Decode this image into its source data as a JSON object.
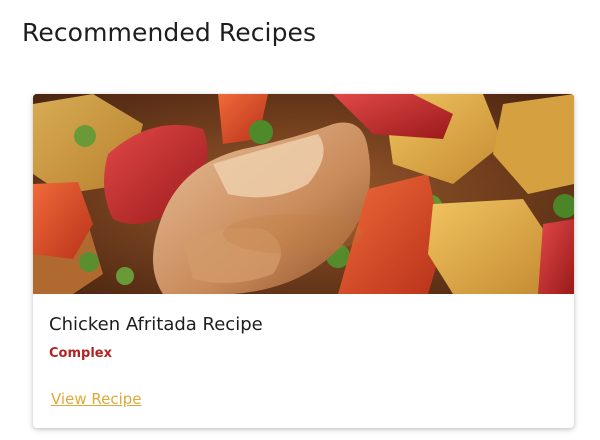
{
  "section": {
    "title": "Recommended Recipes"
  },
  "recipes": [
    {
      "title": "Chicken Afritada Recipe",
      "difficulty": "Complex",
      "link_label": "View Recipe",
      "colors": {
        "difficulty": "#b22424",
        "link": "#e0a838"
      }
    }
  ]
}
